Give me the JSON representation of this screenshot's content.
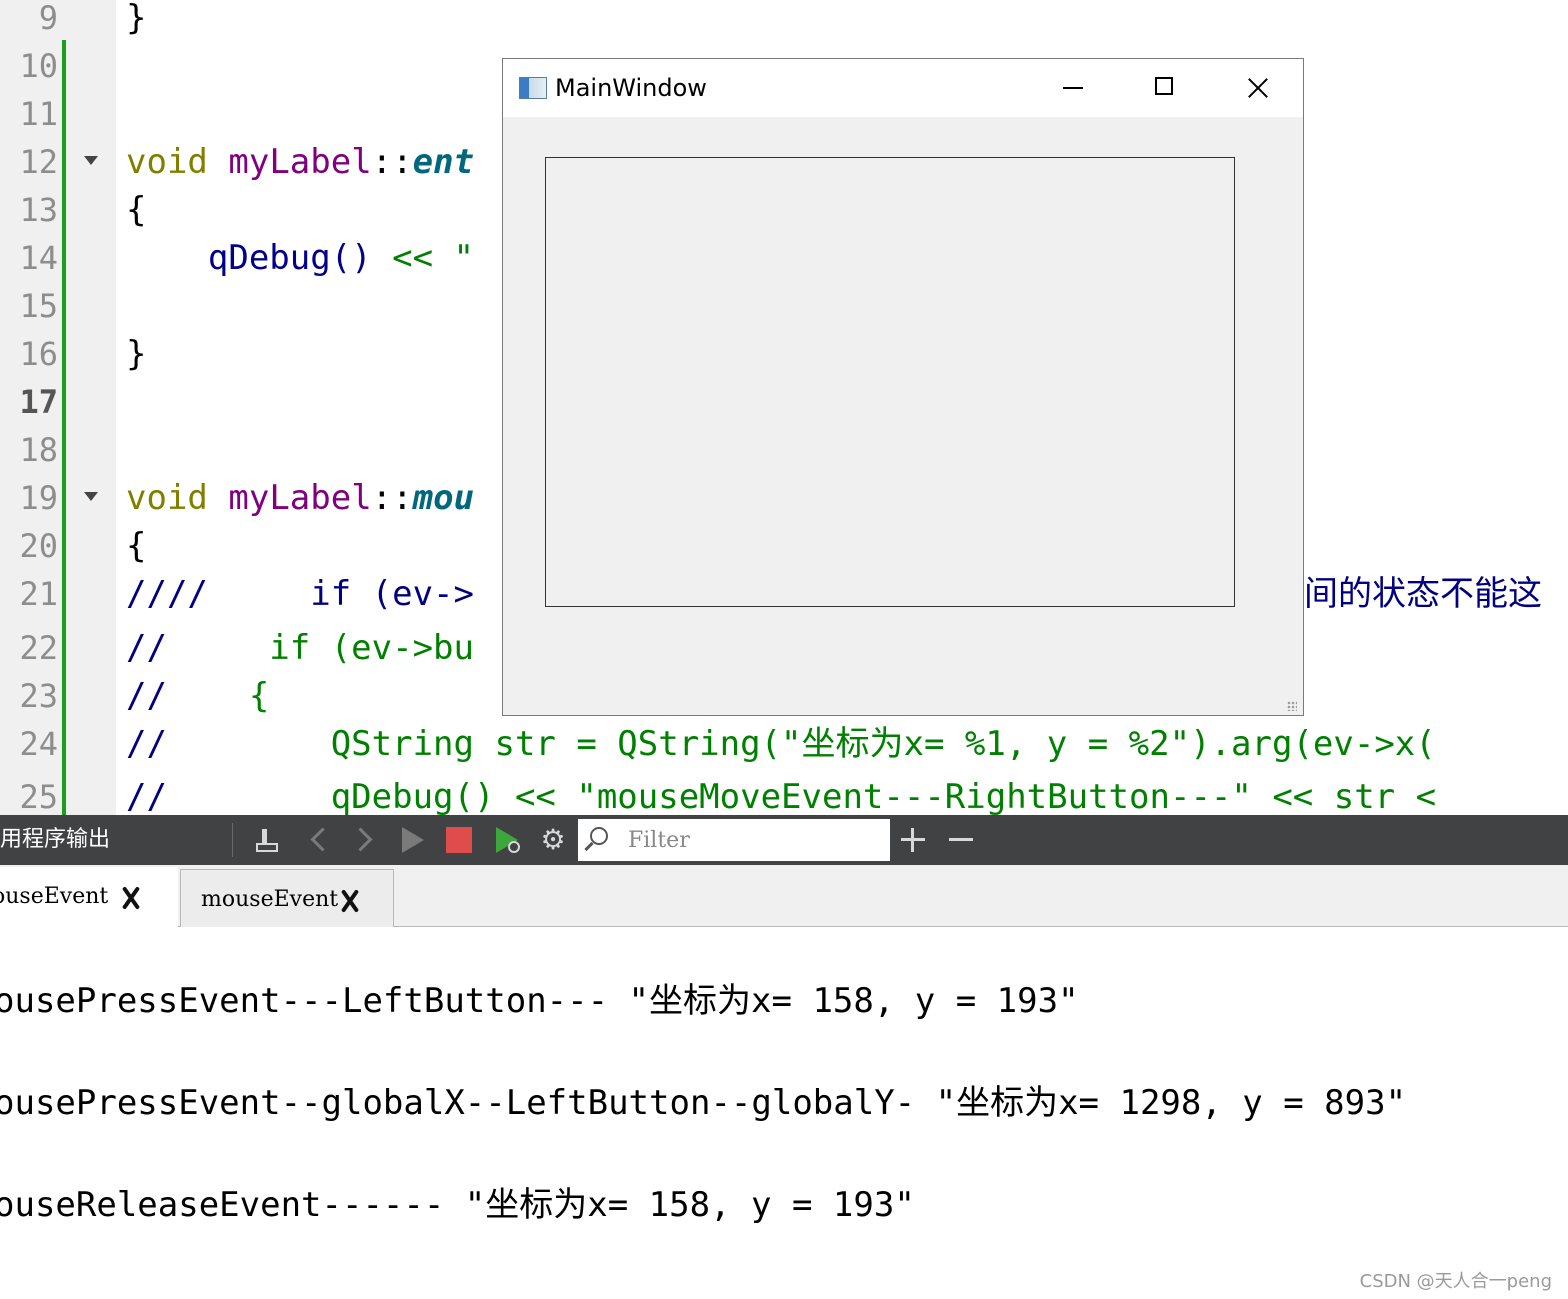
{
  "editor": {
    "lines": [
      {
        "n": "9"
      },
      {
        "n": "10"
      },
      {
        "n": "11"
      },
      {
        "n": "12"
      },
      {
        "n": "13"
      },
      {
        "n": "14"
      },
      {
        "n": "15"
      },
      {
        "n": "16"
      },
      {
        "n": "17"
      },
      {
        "n": "18"
      },
      {
        "n": "19"
      },
      {
        "n": "20"
      },
      {
        "n": "21"
      },
      {
        "n": "22"
      },
      {
        "n": "23"
      },
      {
        "n": "24"
      },
      {
        "n": "25"
      }
    ],
    "code": {
      "l9": "}",
      "l12_kw": "void",
      "l12_cls": "myLabel",
      "l12_sep": "::",
      "l12_fn": "ent",
      "l13": "{",
      "l14_call": "qDebug()",
      "l14_op": " << ",
      "l14_str": "\"",
      "l16": "}",
      "l19_kw": "void",
      "l19_cls": "myLabel",
      "l19_sep": "::",
      "l19_fn": "mou",
      "l20": "{",
      "l21_cm": "////",
      "l21_rest": "     if (ev->",
      "l22_cm": "//",
      "l22_rest": "     if (ev->bu",
      "l23_cm": "//",
      "l23_rest": "    {",
      "l24_cm": "//",
      "l24_rest": "        QString str = QString(\"坐标为x= %1, y = %2\").arg(ev->x(",
      "l25_cm": "//",
      "l25_rest": "        qDebug() << \"mouseMoveEvent---RightButton---\" << str <",
      "l21_right": "间的状态不能这"
    }
  },
  "main_window": {
    "title": "MainWindow"
  },
  "output_pane": {
    "title": "用程序输出",
    "filter_placeholder": "Filter",
    "tabs": [
      {
        "label": "ouseEvent"
      },
      {
        "label": "mouseEvent"
      }
    ],
    "lines": [
      "ousePressEvent---LeftButton--- \"坐标为x= 158, y = 193\"",
      "ousePressEvent--globalX--LeftButton--globalY- \"坐标为x= 1298, y = 893\"",
      "ouseReleaseEvent------ \"坐标为x= 158, y = 193\""
    ]
  },
  "watermark": "CSDN @天人合一peng",
  "colors": {
    "gutter_bar": "#1e9e1e",
    "keyword": "#808000",
    "class": "#800080",
    "function": "#00677c",
    "comment": "#008000",
    "toolbar_bg": "#404244",
    "stop_red": "#e04b4b"
  }
}
